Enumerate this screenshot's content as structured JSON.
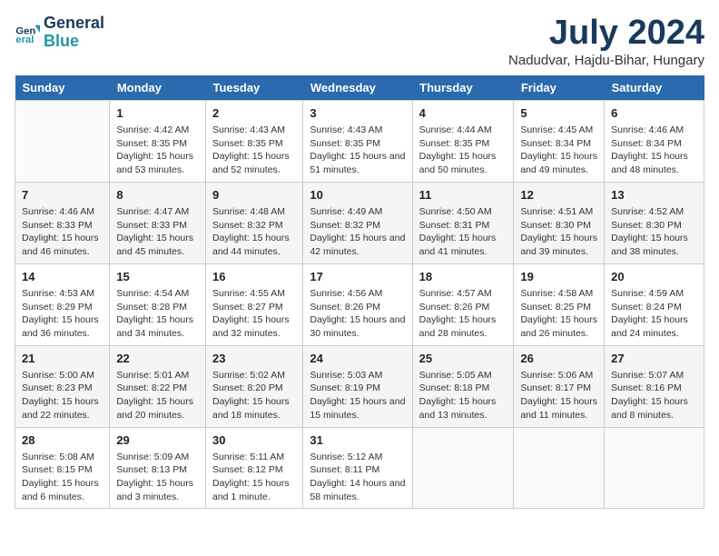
{
  "logo": {
    "line1": "General",
    "line2": "Blue"
  },
  "title": "July 2024",
  "subtitle": "Nadudvar, Hajdu-Bihar, Hungary",
  "days_of_week": [
    "Sunday",
    "Monday",
    "Tuesday",
    "Wednesday",
    "Thursday",
    "Friday",
    "Saturday"
  ],
  "weeks": [
    [
      {
        "day": "",
        "sunrise": "",
        "sunset": "",
        "daylight": ""
      },
      {
        "day": "1",
        "sunrise": "Sunrise: 4:42 AM",
        "sunset": "Sunset: 8:35 PM",
        "daylight": "Daylight: 15 hours and 53 minutes."
      },
      {
        "day": "2",
        "sunrise": "Sunrise: 4:43 AM",
        "sunset": "Sunset: 8:35 PM",
        "daylight": "Daylight: 15 hours and 52 minutes."
      },
      {
        "day": "3",
        "sunrise": "Sunrise: 4:43 AM",
        "sunset": "Sunset: 8:35 PM",
        "daylight": "Daylight: 15 hours and 51 minutes."
      },
      {
        "day": "4",
        "sunrise": "Sunrise: 4:44 AM",
        "sunset": "Sunset: 8:35 PM",
        "daylight": "Daylight: 15 hours and 50 minutes."
      },
      {
        "day": "5",
        "sunrise": "Sunrise: 4:45 AM",
        "sunset": "Sunset: 8:34 PM",
        "daylight": "Daylight: 15 hours and 49 minutes."
      },
      {
        "day": "6",
        "sunrise": "Sunrise: 4:46 AM",
        "sunset": "Sunset: 8:34 PM",
        "daylight": "Daylight: 15 hours and 48 minutes."
      }
    ],
    [
      {
        "day": "7",
        "sunrise": "Sunrise: 4:46 AM",
        "sunset": "Sunset: 8:33 PM",
        "daylight": "Daylight: 15 hours and 46 minutes."
      },
      {
        "day": "8",
        "sunrise": "Sunrise: 4:47 AM",
        "sunset": "Sunset: 8:33 PM",
        "daylight": "Daylight: 15 hours and 45 minutes."
      },
      {
        "day": "9",
        "sunrise": "Sunrise: 4:48 AM",
        "sunset": "Sunset: 8:32 PM",
        "daylight": "Daylight: 15 hours and 44 minutes."
      },
      {
        "day": "10",
        "sunrise": "Sunrise: 4:49 AM",
        "sunset": "Sunset: 8:32 PM",
        "daylight": "Daylight: 15 hours and 42 minutes."
      },
      {
        "day": "11",
        "sunrise": "Sunrise: 4:50 AM",
        "sunset": "Sunset: 8:31 PM",
        "daylight": "Daylight: 15 hours and 41 minutes."
      },
      {
        "day": "12",
        "sunrise": "Sunrise: 4:51 AM",
        "sunset": "Sunset: 8:30 PM",
        "daylight": "Daylight: 15 hours and 39 minutes."
      },
      {
        "day": "13",
        "sunrise": "Sunrise: 4:52 AM",
        "sunset": "Sunset: 8:30 PM",
        "daylight": "Daylight: 15 hours and 38 minutes."
      }
    ],
    [
      {
        "day": "14",
        "sunrise": "Sunrise: 4:53 AM",
        "sunset": "Sunset: 8:29 PM",
        "daylight": "Daylight: 15 hours and 36 minutes."
      },
      {
        "day": "15",
        "sunrise": "Sunrise: 4:54 AM",
        "sunset": "Sunset: 8:28 PM",
        "daylight": "Daylight: 15 hours and 34 minutes."
      },
      {
        "day": "16",
        "sunrise": "Sunrise: 4:55 AM",
        "sunset": "Sunset: 8:27 PM",
        "daylight": "Daylight: 15 hours and 32 minutes."
      },
      {
        "day": "17",
        "sunrise": "Sunrise: 4:56 AM",
        "sunset": "Sunset: 8:26 PM",
        "daylight": "Daylight: 15 hours and 30 minutes."
      },
      {
        "day": "18",
        "sunrise": "Sunrise: 4:57 AM",
        "sunset": "Sunset: 8:26 PM",
        "daylight": "Daylight: 15 hours and 28 minutes."
      },
      {
        "day": "19",
        "sunrise": "Sunrise: 4:58 AM",
        "sunset": "Sunset: 8:25 PM",
        "daylight": "Daylight: 15 hours and 26 minutes."
      },
      {
        "day": "20",
        "sunrise": "Sunrise: 4:59 AM",
        "sunset": "Sunset: 8:24 PM",
        "daylight": "Daylight: 15 hours and 24 minutes."
      }
    ],
    [
      {
        "day": "21",
        "sunrise": "Sunrise: 5:00 AM",
        "sunset": "Sunset: 8:23 PM",
        "daylight": "Daylight: 15 hours and 22 minutes."
      },
      {
        "day": "22",
        "sunrise": "Sunrise: 5:01 AM",
        "sunset": "Sunset: 8:22 PM",
        "daylight": "Daylight: 15 hours and 20 minutes."
      },
      {
        "day": "23",
        "sunrise": "Sunrise: 5:02 AM",
        "sunset": "Sunset: 8:20 PM",
        "daylight": "Daylight: 15 hours and 18 minutes."
      },
      {
        "day": "24",
        "sunrise": "Sunrise: 5:03 AM",
        "sunset": "Sunset: 8:19 PM",
        "daylight": "Daylight: 15 hours and 15 minutes."
      },
      {
        "day": "25",
        "sunrise": "Sunrise: 5:05 AM",
        "sunset": "Sunset: 8:18 PM",
        "daylight": "Daylight: 15 hours and 13 minutes."
      },
      {
        "day": "26",
        "sunrise": "Sunrise: 5:06 AM",
        "sunset": "Sunset: 8:17 PM",
        "daylight": "Daylight: 15 hours and 11 minutes."
      },
      {
        "day": "27",
        "sunrise": "Sunrise: 5:07 AM",
        "sunset": "Sunset: 8:16 PM",
        "daylight": "Daylight: 15 hours and 8 minutes."
      }
    ],
    [
      {
        "day": "28",
        "sunrise": "Sunrise: 5:08 AM",
        "sunset": "Sunset: 8:15 PM",
        "daylight": "Daylight: 15 hours and 6 minutes."
      },
      {
        "day": "29",
        "sunrise": "Sunrise: 5:09 AM",
        "sunset": "Sunset: 8:13 PM",
        "daylight": "Daylight: 15 hours and 3 minutes."
      },
      {
        "day": "30",
        "sunrise": "Sunrise: 5:11 AM",
        "sunset": "Sunset: 8:12 PM",
        "daylight": "Daylight: 15 hours and 1 minute."
      },
      {
        "day": "31",
        "sunrise": "Sunrise: 5:12 AM",
        "sunset": "Sunset: 8:11 PM",
        "daylight": "Daylight: 14 hours and 58 minutes."
      },
      {
        "day": "",
        "sunrise": "",
        "sunset": "",
        "daylight": ""
      },
      {
        "day": "",
        "sunrise": "",
        "sunset": "",
        "daylight": ""
      },
      {
        "day": "",
        "sunrise": "",
        "sunset": "",
        "daylight": ""
      }
    ]
  ]
}
